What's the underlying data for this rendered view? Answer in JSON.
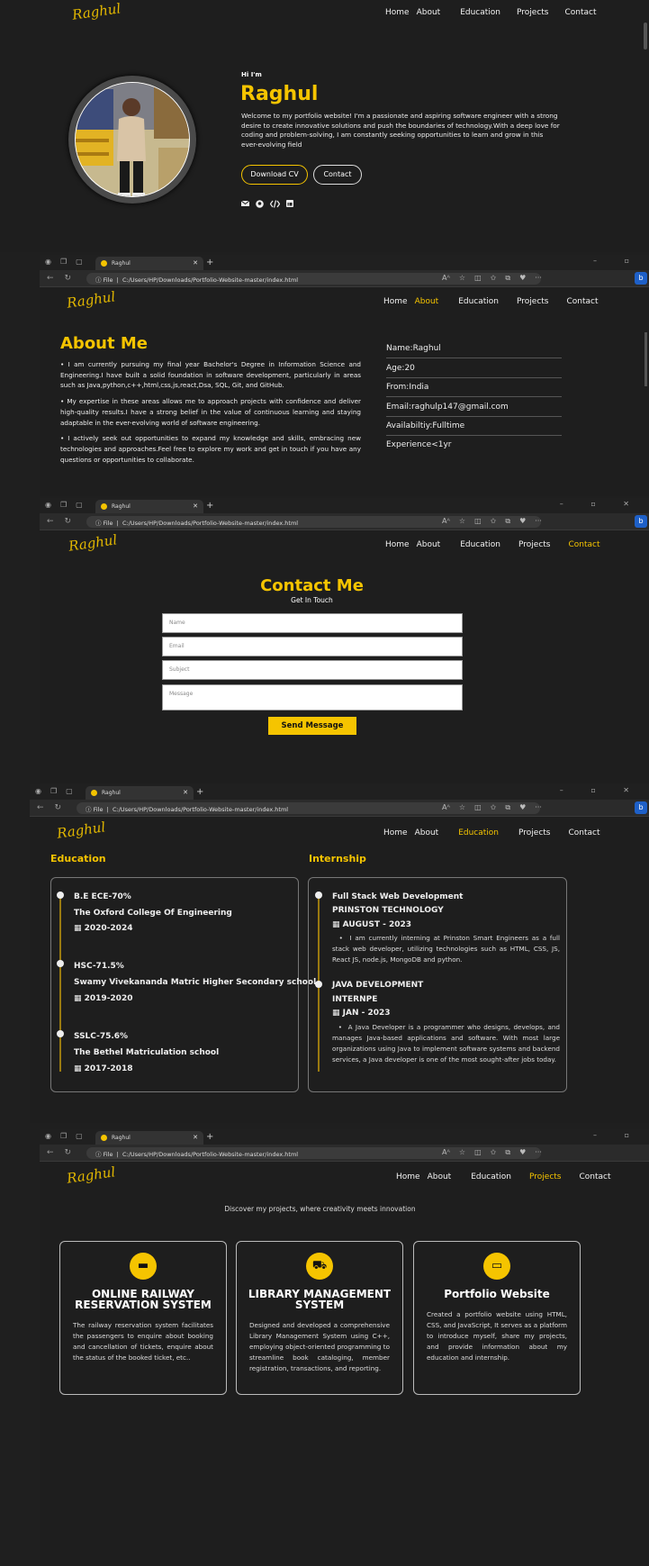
{
  "nav": {
    "home": "Home",
    "about": "About",
    "education": "Education",
    "projects": "Projects",
    "contact": "Contact"
  },
  "logo": "Raghul",
  "hero": {
    "greeting": "Hi I'm",
    "name": "Raghul",
    "intro": "Welcome to my portfolio website! I'm a passionate and aspiring software engineer with a strong desire to create innovative solutions and push the boundaries of technology.With a deep love for coding and problem-solving, I am constantly seeking opportunities to learn and grow in this ever-evolving field",
    "download_cv": "Download CV",
    "contact_btn": "Contact",
    "social_icons": [
      "mail-icon",
      "github-icon",
      "code-icon",
      "linkedin-icon"
    ]
  },
  "browser": {
    "tab_title": "Raghul",
    "file_label": "File",
    "url": "C:/Users/HP/Downloads/Portfolio-Website-master/index.html"
  },
  "about": {
    "title": "About Me",
    "points": [
      "I am currently pursuing my final year Bachelor's Degree in Information Science and Engineering.I have built a solid foundation in software development, particularly in areas such as Java,python,c++,html,css,js,react,Dsa, SQL, Git, and GitHub.",
      "My expertise in these areas allows me to approach projects with confidence and deliver high-quality results.I have a strong belief in the value of continuous learning and staying adaptable in the ever-evolving world of software engineering.",
      "I actively seek out opportunities to expand my knowledge and skills, embracing new technologies and approaches.Feel free to explore my work and get in touch if you have any questions or opportunities to collaborate."
    ],
    "info": [
      "Name:Raghul",
      "Age:20",
      "From:India",
      "Email:raghulp147@gmail.com",
      "Availabiltiy:Fulltime",
      "Experience<1yr"
    ]
  },
  "contact": {
    "title": "Contact Me",
    "subtitle": "Get In Touch",
    "name_ph": "Name",
    "email_ph": "Email",
    "subject_ph": "Subject",
    "message_ph": "Message",
    "send": "Send Message"
  },
  "education": {
    "title": "Education",
    "items": [
      {
        "degree": "B.E ECE-70%",
        "school": "The Oxford College Of Engineering",
        "years": "2020-2024"
      },
      {
        "degree": "HSC-71.5%",
        "school": "Swamy Vivekananda Matric Higher Secondary school",
        "years": "2019-2020"
      },
      {
        "degree": "SSLC-75.6%",
        "school": "The Bethel Matriculation school",
        "years": "2017-2018"
      }
    ]
  },
  "internship": {
    "title": "Internship",
    "items": [
      {
        "role": "Full Stack Web Development",
        "company": "PRINSTON TECHNOLOGY",
        "date": "AUGUST - 2023",
        "desc": "I am currently interning at Prinston Smart Engineers as a full stack web developer, utilizing technologies such as HTML, CSS, JS, React JS, node.js, MongoDB and python."
      },
      {
        "role": "JAVA DEVELOPMENT",
        "company": "INTERNPE",
        "date": "JAN - 2023",
        "desc": "A Java Developer is a programmer who designs, develops, and manages Java-based applications and software. With most large organizations using Java to implement software systems and backend services, a Java developer is one of the most sought-after jobs today."
      }
    ]
  },
  "projects": {
    "subtitle": "Discover my projects, where creativity meets innovation",
    "items": [
      {
        "title": "ONLINE RAILWAY RESERVATION SYSTEM",
        "desc": "The railway reservation system facilitates the passengers to enquire about booking and cancellation of tickets, enquire about the status of the booked ticket, etc..",
        "icon": "train-icon"
      },
      {
        "title": "LIBRARY MANAGEMENT SYSTEM",
        "desc": "Designed and developed a comprehensive Library Management System using C++, employing object-oriented programming to streamline book cataloging, member registration, transactions, and reporting.",
        "icon": "car-icon"
      },
      {
        "title": "Portfolio Website",
        "desc": "Created a portfolio website using HTML, CSS, and JavaScript, It serves as a platform to introduce myself, share my projects, and provide information about my education and internship.",
        "icon": "monitor-icon"
      }
    ]
  }
}
